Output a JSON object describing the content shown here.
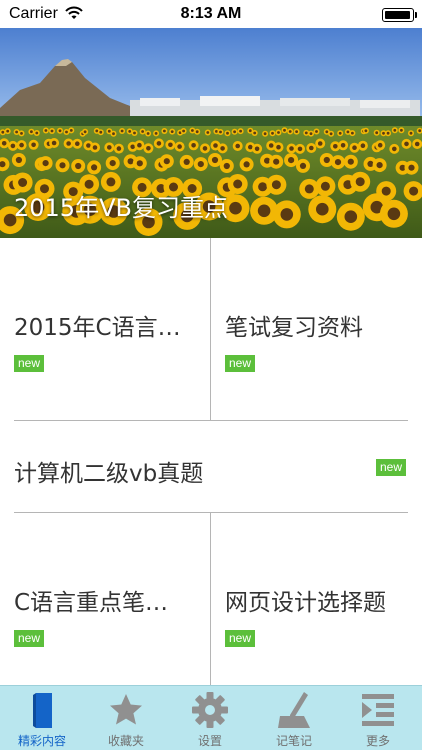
{
  "status_bar": {
    "carrier": "Carrier",
    "time": "8:13 AM",
    "battery_level": 1.0
  },
  "hero": {
    "title": "2015年VB复习重点"
  },
  "grid": {
    "cells": [
      {
        "title": "2015年C语言…",
        "badge": "new"
      },
      {
        "title": "笔试复习资料",
        "badge": "new"
      },
      {
        "title": "计算机二级vb真题",
        "badge": "new"
      },
      {
        "title": "C语言重点笔…",
        "badge": "new"
      },
      {
        "title": "网页设计选择题",
        "badge": "new"
      }
    ]
  },
  "tabbar": {
    "tabs": [
      {
        "label": "精彩内容",
        "icon": "document-icon",
        "active": true
      },
      {
        "label": "收藏夹",
        "icon": "star-icon",
        "active": false
      },
      {
        "label": "设置",
        "icon": "gear-icon",
        "active": false
      },
      {
        "label": "记笔记",
        "icon": "note-pen-icon",
        "active": false
      },
      {
        "label": "更多",
        "icon": "more-list-icon",
        "active": false
      }
    ]
  },
  "colors": {
    "badge": "#5cbf3b",
    "tabbar_bg": "#b9e6ee",
    "active_tab": "#1464c8",
    "inactive_icon": "#909090",
    "divider": "#b5b5b5"
  }
}
